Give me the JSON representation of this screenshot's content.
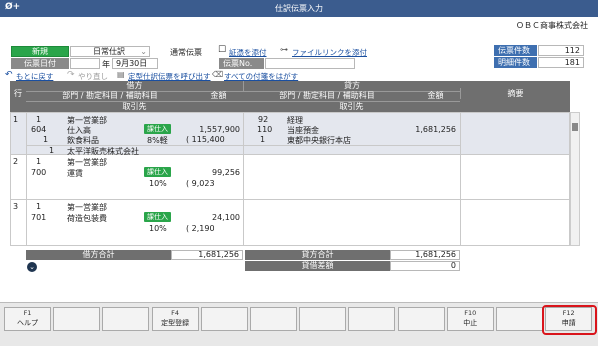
{
  "window": {
    "logo": "Ø+",
    "title": "仕訳伝票入力",
    "company": "ＯＢＣ商事株式会社"
  },
  "header": {
    "mode": "新規",
    "entry_type": "日常仕訳",
    "voucher_type": "通常伝票",
    "date_label": "伝票日付",
    "year_prefix": "年",
    "date_value": "9月30日",
    "no_label": "伝票No.",
    "no_value": "",
    "attach_evidence": "証憑を添付",
    "attach_file": "ファイルリンクを添付",
    "count_label": "伝票件数",
    "count_value": "112",
    "detail_label": "明細件数",
    "detail_value": "181"
  },
  "toolbar": {
    "undo": "もとに戻す",
    "redo": "やり直し",
    "call_template": "定型仕訳伝票を呼び出す",
    "remove_attach": "すべての付箋をはがす"
  },
  "grid": {
    "row_head": "行",
    "debit": "借方",
    "credit": "貸方",
    "dept": "部門 / 勘定科目 / 補助科目",
    "amount": "金額",
    "partner": "取引先",
    "memo": "摘要"
  },
  "rows": [
    {
      "no": "1",
      "d_code1": "1",
      "d_name1": "第一営業部",
      "d_code2": "604",
      "d_name2": "仕入高",
      "d_tag": "課仕入",
      "d_amount": "1,557,900",
      "d_code3": "1",
      "d_name3": "飲食料品",
      "d_rate": "8%軽",
      "d_tax": "( 115,400",
      "c_code1": "92",
      "c_name1": "経理",
      "c_code2": "110",
      "c_name2": "当座預金",
      "c_amount": "1,681,256",
      "c_code3": "1",
      "c_name3": "東都中央銀行本店",
      "p_code": "1",
      "p_name": "太平洋販売株式会社"
    },
    {
      "no": "2",
      "d_code1": "1",
      "d_name1": "第一営業部",
      "d_code2": "700",
      "d_name2": "運賃",
      "d_tag": "課仕入",
      "d_amount": "99,256",
      "d_rate": "10%",
      "d_tax": "( 9,023"
    },
    {
      "no": "3",
      "d_code1": "1",
      "d_name1": "第一営業部",
      "d_code2": "701",
      "d_name2": "荷造包装費",
      "d_tag": "課仕入",
      "d_amount": "24,100",
      "d_rate": "10%",
      "d_tax": "( 2,190"
    }
  ],
  "totals": {
    "debit_label": "借方合計",
    "debit_value": "1,681,256",
    "credit_label": "貸方合計",
    "credit_value": "1,681,256",
    "diff_label": "貸借差額",
    "diff_value": "0"
  },
  "fkeys": [
    {
      "key": "F1",
      "label": "ヘルプ"
    },
    {
      "key": "",
      "label": ""
    },
    {
      "key": "",
      "label": ""
    },
    {
      "key": "F4",
      "label": "定型登録"
    },
    {
      "key": "",
      "label": ""
    },
    {
      "key": "",
      "label": ""
    },
    {
      "key": "",
      "label": ""
    },
    {
      "key": "",
      "label": ""
    },
    {
      "key": "",
      "label": ""
    },
    {
      "key": "F10",
      "label": "中止"
    },
    {
      "key": "",
      "label": ""
    },
    {
      "key": "F12",
      "label": "申請"
    }
  ],
  "colors": {
    "accent": "#2aa54a",
    "highlight": "#d9141b",
    "titlebar": "#3b5c8e"
  }
}
